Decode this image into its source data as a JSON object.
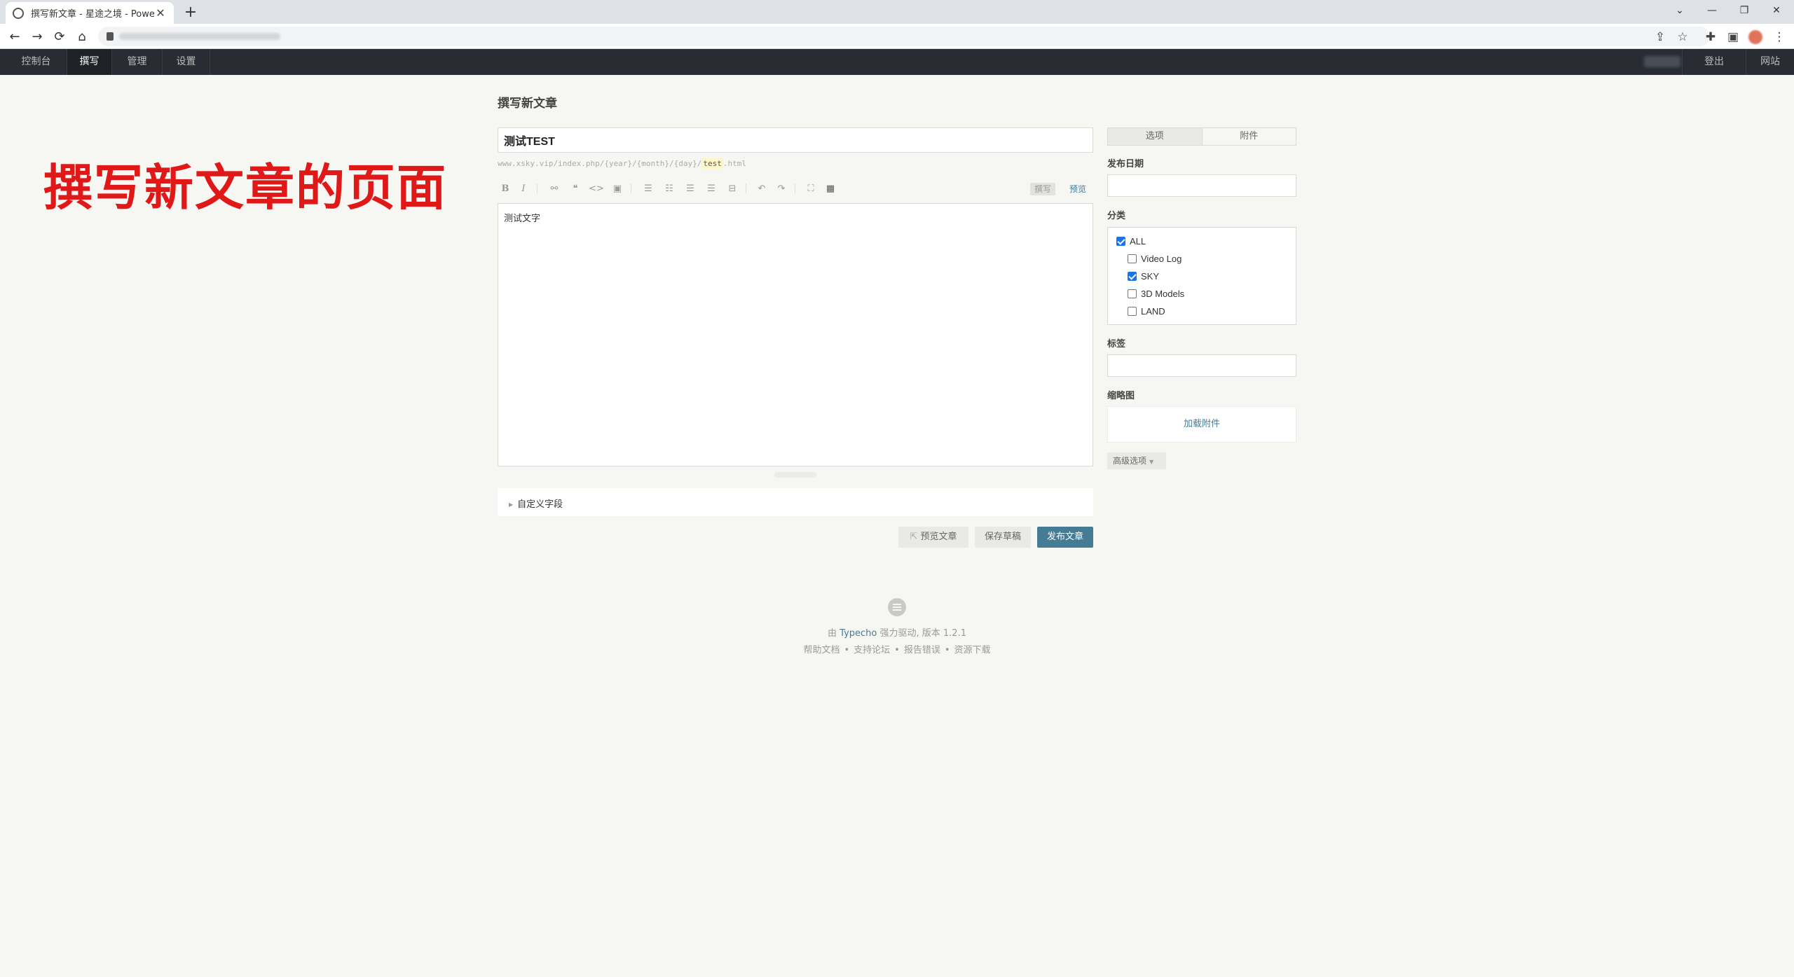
{
  "browser": {
    "tab_title": "撰写新文章 - 星途之境 - Powere",
    "tab_close": "✕",
    "new_tab": "+",
    "window_controls": {
      "dropdown": "⌄",
      "minimize": "—",
      "restore": "❐",
      "close": "✕"
    },
    "nav": {
      "back": "←",
      "forward": "→",
      "reload": "⟳",
      "home": "⌂"
    },
    "toolbar_icons": {
      "share": "⇪",
      "bookmark": "☆",
      "extensions": "✚",
      "sidebar": "▣",
      "menu": "⋮"
    }
  },
  "admin_menu": {
    "items": [
      "控制台",
      "撰写",
      "管理",
      "设置"
    ],
    "active": "撰写",
    "logout": "登出",
    "site": "网站"
  },
  "annotation": "撰写新文章的页面",
  "page": {
    "title": "撰写新文章",
    "post_title_value": "测试TEST",
    "permalink_prefix": "www.xsky.vip/index.php/{year}/{month}/{day}/",
    "permalink_slug": "test",
    "permalink_suffix": ".html",
    "editor_content": "测试文字",
    "mode_write": "撰写",
    "mode_preview": "预览",
    "custom_fields": "自定义字段",
    "buttons": {
      "preview": "预览文章",
      "save": "保存草稿",
      "publish": "发布文章"
    },
    "toolbar": {
      "bold": "B",
      "italic": "I",
      "link": "⚯",
      "quote": "❝",
      "code": "<>",
      "image": "▣",
      "ordered_list": "☰",
      "unordered_list": "☷",
      "heading": "☰",
      "hr": "☰",
      "more": "⊟",
      "undo": "↶",
      "redo": "↷",
      "fullscreen": "⛶",
      "media": "▦"
    }
  },
  "sidebar": {
    "tabs": [
      "选项",
      "附件"
    ],
    "publish_date_label": "发布日期",
    "category_label": "分类",
    "categories": [
      {
        "name": "ALL",
        "checked": true
      },
      {
        "name": "Video Log",
        "checked": false
      },
      {
        "name": "SKY",
        "checked": true
      },
      {
        "name": "3D Models",
        "checked": false
      },
      {
        "name": "LAND",
        "checked": false
      }
    ],
    "tags_label": "标签",
    "thumbnail_label": "缩略图",
    "load_attachment": "加载附件",
    "advanced": "高级选项"
  },
  "footer": {
    "powered_prefix": "由",
    "brand": "Typecho",
    "powered_suffix": "强力驱动, 版本 1.2.1",
    "links": [
      "帮助文档",
      "支持论坛",
      "报告错误",
      "资源下载"
    ],
    "separator": "•"
  },
  "colors": {
    "accent": "#467b96",
    "admin_bar": "#292d33",
    "annotation": "#e01818",
    "checkbox": "#1a73e8"
  }
}
